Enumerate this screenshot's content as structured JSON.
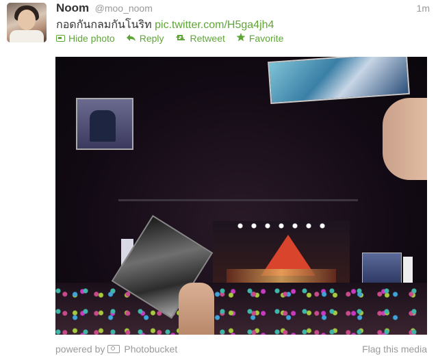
{
  "tweet": {
    "author_name": "Noom",
    "author_handle": "@moo_noom",
    "time": "1m",
    "text": "กอดกันกลมกันโนริท",
    "link": "pic.twitter.com/H5ga4jh4"
  },
  "actions": {
    "hide_photo": "Hide photo",
    "reply": "Reply",
    "retweet": "Retweet",
    "favorite": "Favorite"
  },
  "footer": {
    "powered_by": "powered by",
    "provider": "Photobucket",
    "flag": "Flag this media"
  },
  "colors": {
    "accent": "#5ea636",
    "muted": "#999999",
    "text": "#333333"
  }
}
